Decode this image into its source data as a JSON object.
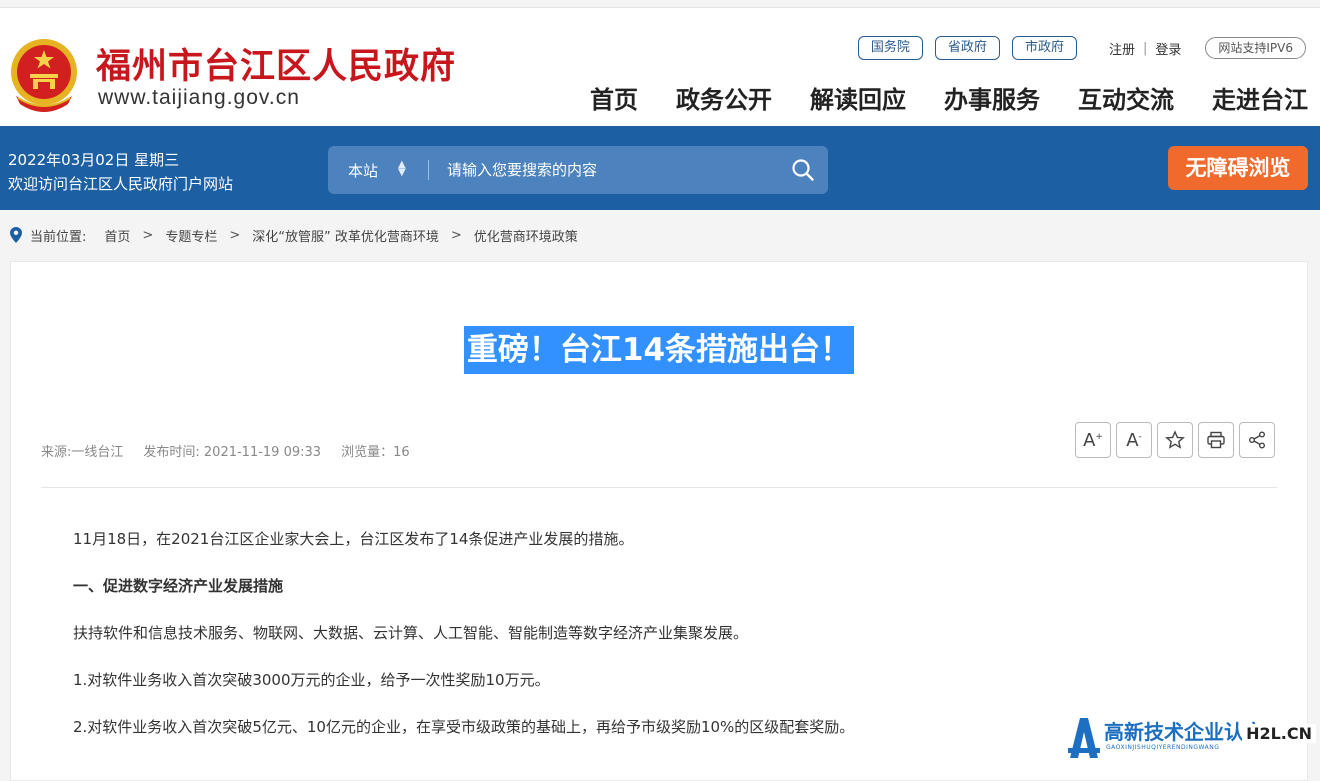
{
  "site": {
    "title": "福州市台江区人民政府",
    "url": "www.taijiang.gov.cn"
  },
  "toplinks": {
    "guowuyuan": "国务院",
    "shengzhengfu": "省政府",
    "shizhengfu": "市政府",
    "register": "注册",
    "separator": "|",
    "login": "登录",
    "ipv6": "网站支持IPV6"
  },
  "nav": [
    "首页",
    "政务公开",
    "解读回应",
    "办事服务",
    "互动交流",
    "走进台江"
  ],
  "bar": {
    "date": "2022年03月02日 星期三",
    "welcome": "欢迎访问台江区人民政府门户网站",
    "search_scope": "本站",
    "search_placeholder": "请输入您要搜索的内容",
    "accessibility": "无障碍浏览"
  },
  "breadcrumb": {
    "label": "当前位置:",
    "items": [
      "首页",
      "专题专栏",
      "深化“放管服” 改革优化营商环境",
      "优化营商环境政策"
    ],
    "sep": ">"
  },
  "article": {
    "title": "重磅！台江14条措施出台！",
    "source": "来源:一线台江",
    "published": "发布时间: 2021-11-19 09:33",
    "views": "浏览量：16",
    "tools": {
      "font_up": "A",
      "font_up_sup": "+",
      "font_down": "A",
      "font_down_sup": "-"
    },
    "paragraphs": [
      "11月18日，在2021台江区企业家大会上，台江区发布了14条促进产业发展的措施。",
      "一、促进数字经济产业发展措施",
      "扶持软件和信息技术服务、物联网、大数据、云计算、人工智能、智能制造等数字经济产业集聚发展。",
      "1.对软件业务收入首次突破3000万元的企业，给予一次性奖励10万元。",
      "2.对软件业务收入首次突破5亿元、10亿元的企业，在享受市级政策的基础上，再给予市级奖励10%的区级配套奖励。"
    ]
  },
  "watermark": {
    "text": "高新技术企业认定",
    "sub": "GAOXINJISHUQIYERENDINGWANG",
    "badge": "H2L.CN"
  },
  "colors": {
    "brand_red": "#c8161d",
    "bar_blue": "#1d5fa3",
    "accent_orange": "#ef6a2c",
    "selection_blue": "#3390ff"
  }
}
